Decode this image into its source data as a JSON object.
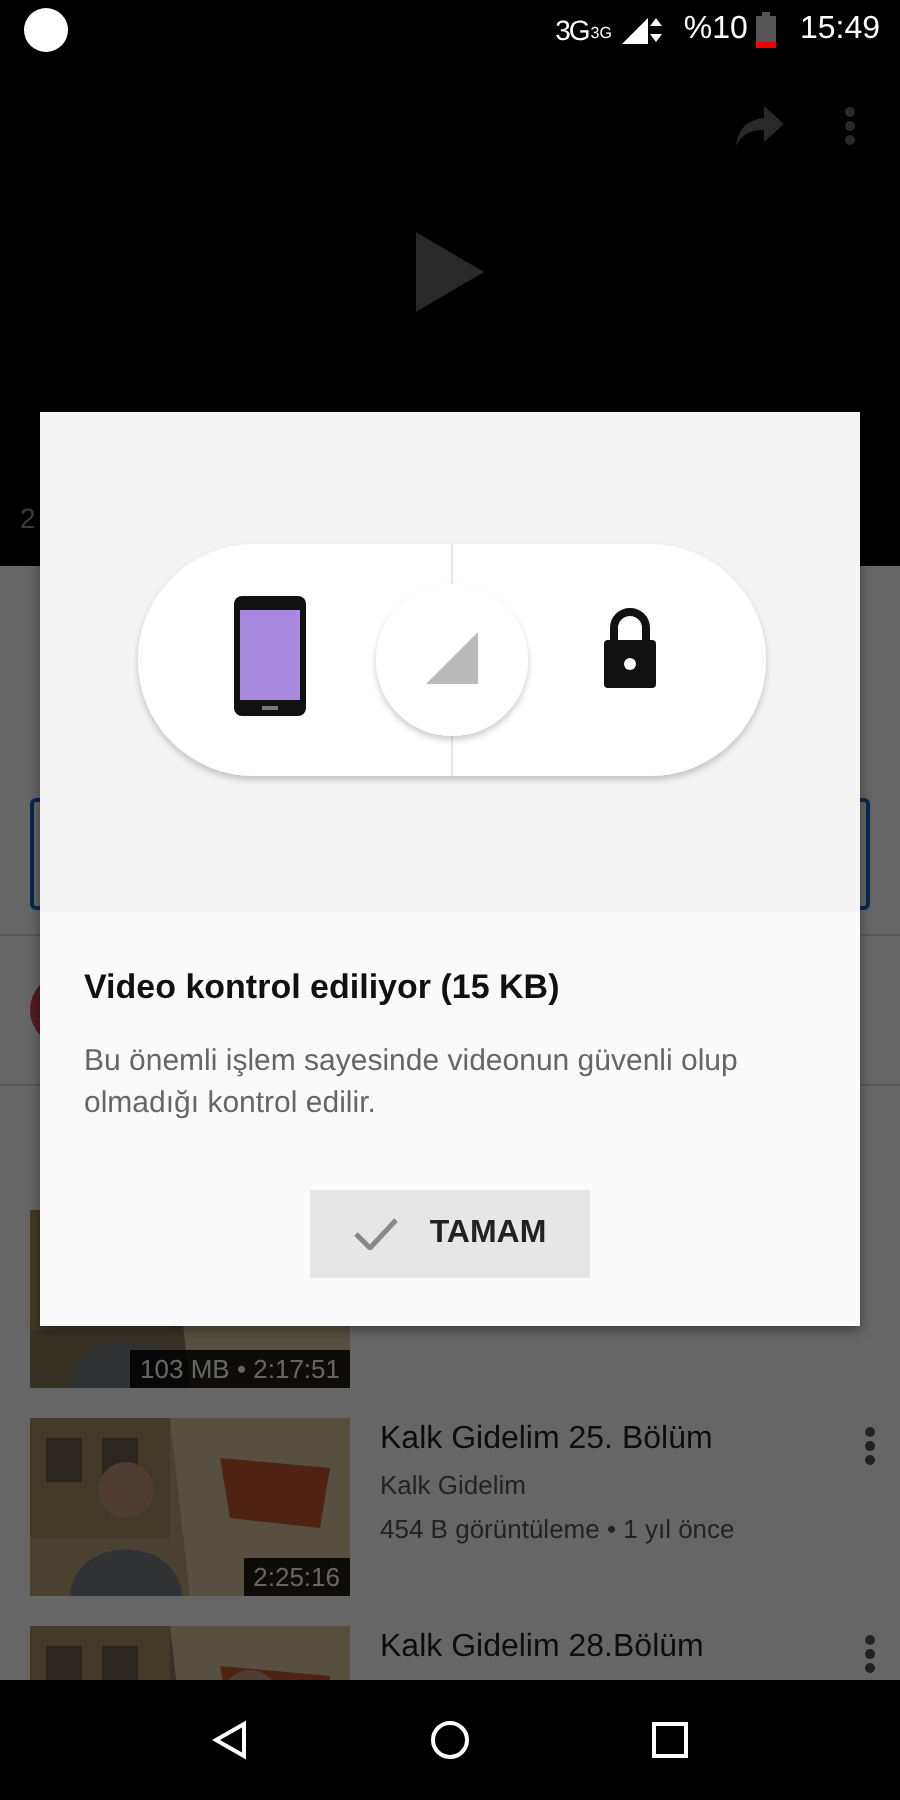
{
  "status_bar": {
    "network": "3G",
    "network_small": "3G",
    "battery": "%10",
    "time": "15:49"
  },
  "player": {
    "caption": "2"
  },
  "dialog": {
    "title": "Video kontrol ediliyor (15 KB)",
    "message": "Bu önemli işlem sayesinde videonun güvenli olup olmadığı kontrol edilir.",
    "button": "TAMAM"
  },
  "videos": [
    {
      "badge": "103 MB • 2:17:51"
    },
    {
      "title": "Kalk Gidelim 25. Bölüm",
      "channel": "Kalk Gidelim",
      "meta": "454 B görüntüleme • 1 yıl önce",
      "badge": "2:25:16"
    },
    {
      "title": "Kalk Gidelim 28.Bölüm"
    }
  ]
}
